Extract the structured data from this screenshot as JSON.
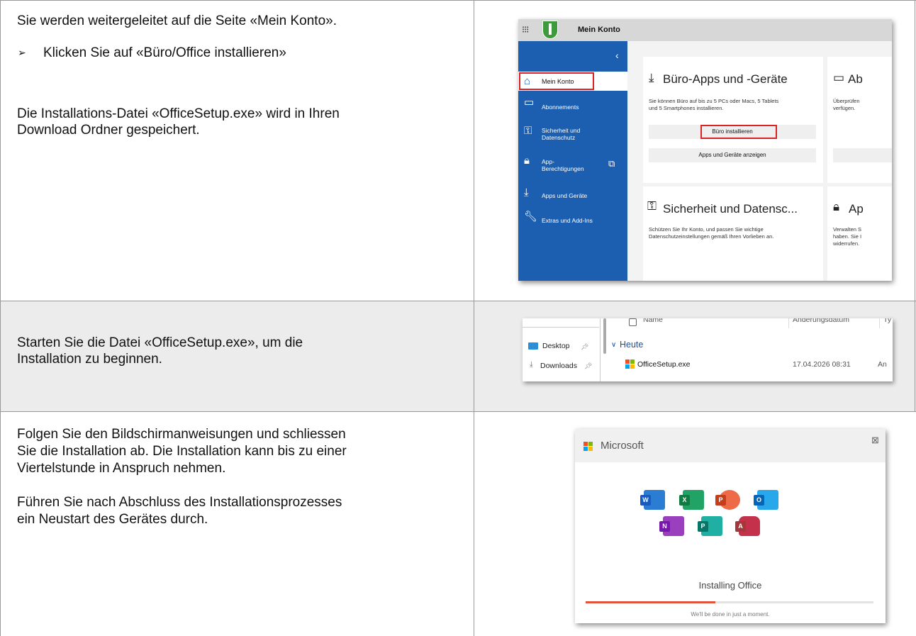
{
  "step1": {
    "line1": "Sie werden weitergeleitet auf die Seite «Mein Konto».",
    "bullet": "Klicken Sie auf «Büro/Office installieren»",
    "line2a": "Die Installations-Datei «OfficeSetup.exe» wird in Ihren",
    "line2b": "Download Ordner gespeichert."
  },
  "step2": {
    "line1": "Starten Sie die Datei «OfficeSetup.exe», um die",
    "line2": "Installation zu beginnen."
  },
  "step3": {
    "lines": [
      "Folgen Sie den Bildschirmanweisungen und schliessen",
      "Sie die Installation ab. Die Installation kann bis zu einer",
      "Viertelstunde in Anspruch nehmen."
    ],
    "lines2": [
      "Führen Sie nach Abschluss des Installationsprozesses",
      "ein Neustart des Gerätes durch."
    ]
  },
  "account": {
    "title": "Mein Konto",
    "nav": [
      {
        "label": "Mein Konto",
        "icon": "home-icon"
      },
      {
        "label": "Abonnements",
        "icon": "card-icon"
      },
      {
        "label1": "Sicherheit und",
        "label2": "Datenschutz",
        "icon": "key-icon"
      },
      {
        "label1": "App-",
        "label2": "Berechtigungen",
        "icon": "lock-icon"
      },
      {
        "label": "Apps und Geräte",
        "icon": "download-icon"
      },
      {
        "label": "Extras und Add-Ins",
        "icon": "wrench-icon"
      }
    ],
    "card1": {
      "title": "Büro-Apps und -Geräte",
      "desc1": "Sie können Büro auf bis zu 5 PCs oder Macs, 5 Tablets",
      "desc2": "und 5 Smartphones installieren.",
      "btn_install": "Büro installieren",
      "btn_apps": "Apps und Geräte anzeigen"
    },
    "card2": {
      "title": "Ab",
      "desc1": "Überprüfen",
      "desc2": "verfügen."
    },
    "card3": {
      "title": "Sicherheit und Datensc...",
      "desc1": "Schützen Sie Ihr Konto, und passen Sie wichtige",
      "desc2": "Datenschutzeinstellungen gemäß Ihren Vorlieben an."
    },
    "card4": {
      "title": "Ap",
      "desc1": "Verwalten S",
      "desc2": "haben. Sie I",
      "desc3": "widerrufen."
    },
    "colors": {
      "nav_bg": "#1c5fb0",
      "highlight": "#dd2222"
    }
  },
  "explorer": {
    "col_name": "Name",
    "col_date": "Änderungsdatum",
    "col_type": "Ty",
    "quick": [
      {
        "label": "Desktop",
        "icon": "desktop-icon"
      },
      {
        "label": "Downloads",
        "icon": "download-icon"
      }
    ],
    "group": "Heute",
    "file": {
      "name": "OfficeSetup.exe",
      "date": "17.04.2026 08:31",
      "type": "An"
    }
  },
  "installer": {
    "brand": "Microsoft",
    "status": "Installing Office",
    "sub": "We'll be done in just a moment.",
    "progress": 0.45,
    "apps": [
      {
        "letter": "W",
        "name": "word-icon"
      },
      {
        "letter": "X",
        "name": "excel-icon"
      },
      {
        "letter": "P",
        "name": "powerpoint-icon"
      },
      {
        "letter": "O",
        "name": "outlook-icon"
      },
      {
        "letter": "N",
        "name": "onenote-icon"
      },
      {
        "letter": "P",
        "name": "publisher-icon"
      },
      {
        "letter": "A",
        "name": "access-icon"
      }
    ]
  }
}
